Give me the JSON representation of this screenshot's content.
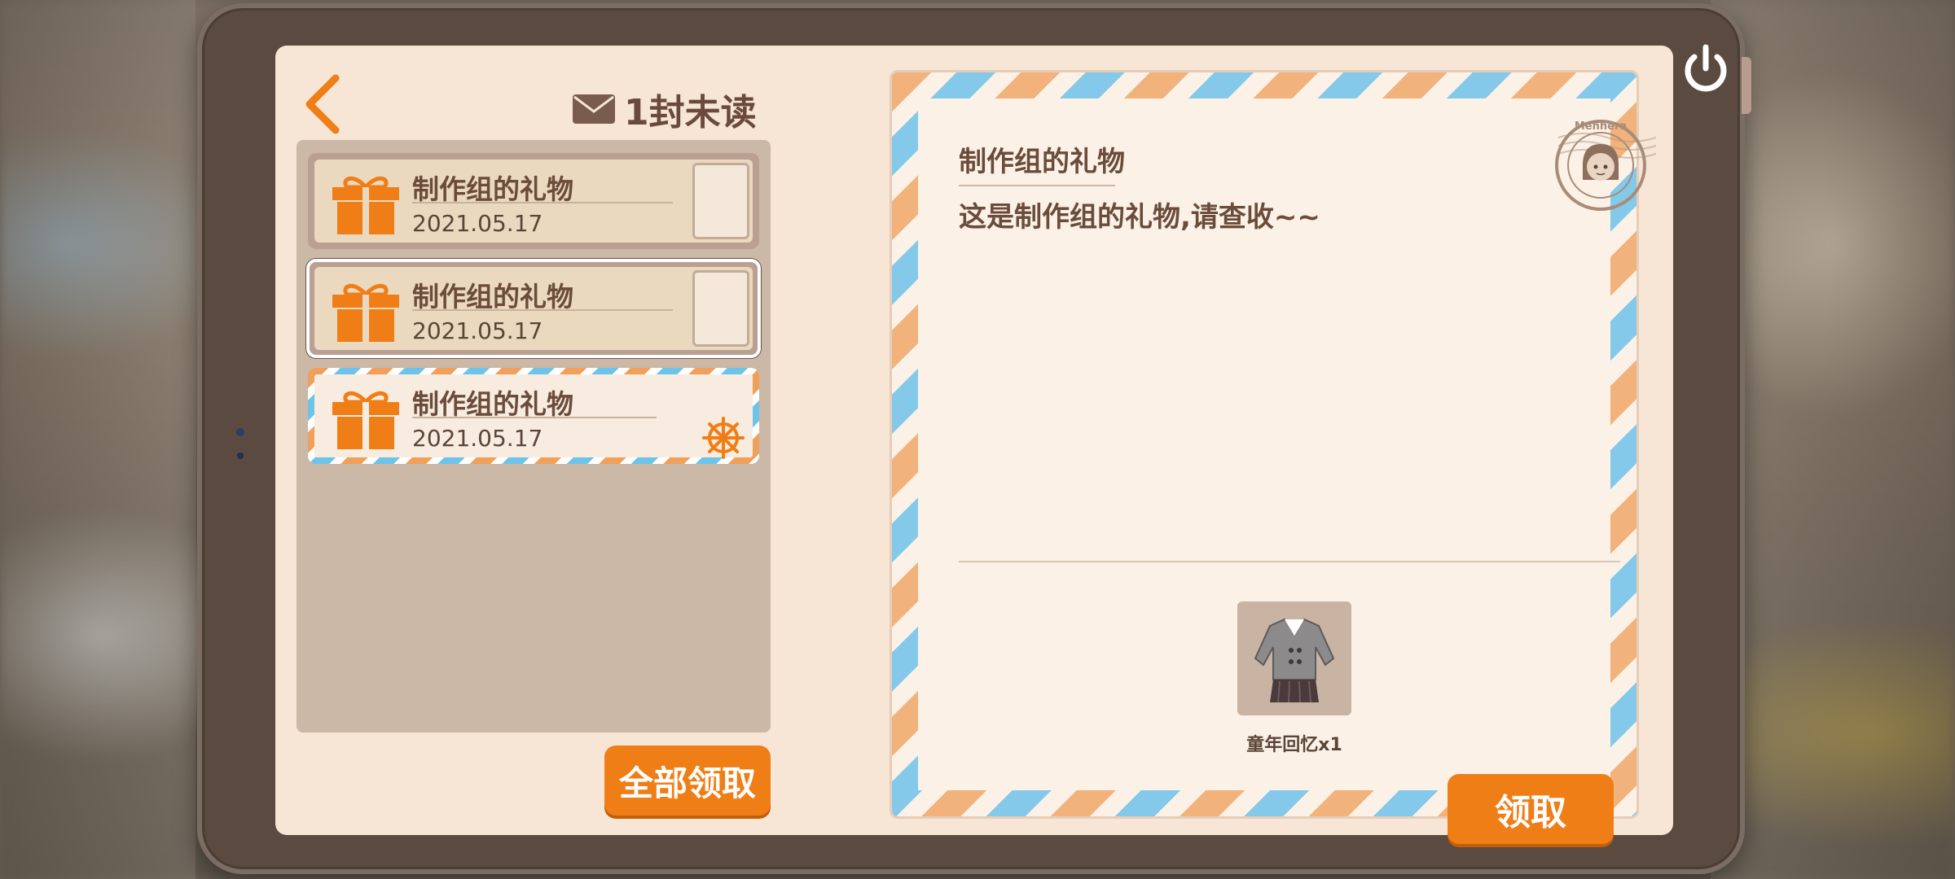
{
  "header": {
    "unread_count_label": "1封未读"
  },
  "mail_list": [
    {
      "title": "制作组的礼物",
      "date": "2021.05.17",
      "state": "read"
    },
    {
      "title": "制作组的礼物",
      "date": "2021.05.17",
      "state": "read-selected"
    },
    {
      "title": "制作组的礼物",
      "date": "2021.05.17",
      "state": "unread"
    }
  ],
  "claim_all_label": "全部领取",
  "letter": {
    "title": "制作组的礼物",
    "body": "这是制作组的礼物,请查收~~",
    "stamp_text": "Menhera",
    "reward": {
      "label": "童年回忆x1"
    },
    "claim_label": "领取"
  },
  "colors": {
    "accent": "#f07e16",
    "text": "#6b4c3b",
    "paper": "#fbf1e6",
    "stripe_orange": "#f2b27c",
    "stripe_blue": "#84c9ea"
  },
  "icons": [
    "back-icon",
    "envelope-icon",
    "gift-icon",
    "power-icon",
    "stamp-icon",
    "ship-wheel-icon",
    "outfit-icon"
  ]
}
